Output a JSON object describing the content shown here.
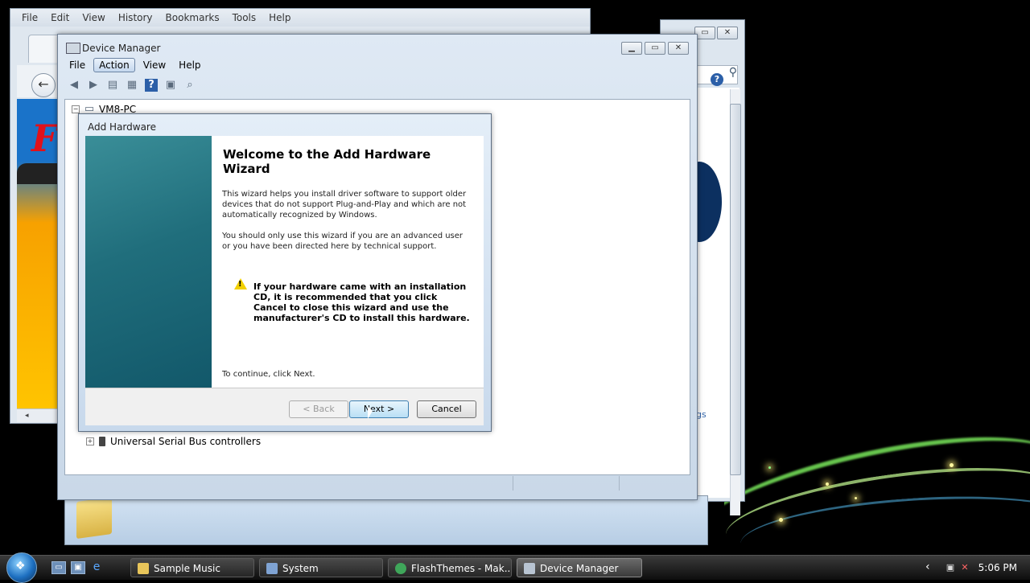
{
  "browser": {
    "menu": [
      "File",
      "Edit",
      "View",
      "History",
      "Bookmarks",
      "Tools",
      "Help"
    ],
    "logo_text": "F"
  },
  "explorer": {
    "link_fragment": "gs"
  },
  "device_manager": {
    "title": "Device Manager",
    "menu": [
      "File",
      "Action",
      "View",
      "Help"
    ],
    "active_menu": "Action",
    "tree_root": "VM8-PC",
    "tree_items": [
      "Universal Serial Bus controllers"
    ]
  },
  "dialog": {
    "title": "Add Hardware",
    "heading": "Welcome to the Add Hardware Wizard",
    "para1": "This wizard helps you install driver software to support older devices that do not support Plug-and-Play and which are not automatically recognized by Windows.",
    "para2": "You should only use this wizard if you are an advanced user or you have been directed here by technical support.",
    "warning": "If your hardware came with an installation CD, it is recommended that you click Cancel to close this wizard and use the manufacturer's CD to install this hardware.",
    "continue_text": "To continue, click Next.",
    "back_label": "< Back",
    "next_label": "Next >",
    "cancel_label": "Cancel"
  },
  "taskbar": {
    "items": [
      {
        "label": "Sample Music",
        "icon": "folder-icon"
      },
      {
        "label": "System",
        "icon": "system-icon"
      },
      {
        "label": "FlashThemes - Mak...",
        "icon": "browser-icon"
      },
      {
        "label": "Device Manager",
        "icon": "device-manager-icon"
      }
    ],
    "clock": "5:06 PM"
  },
  "colors": {
    "wizard_side_panel": "#206e7c",
    "warning_yellow": "#f2d000",
    "focus_blue": "#3c7fb1"
  }
}
